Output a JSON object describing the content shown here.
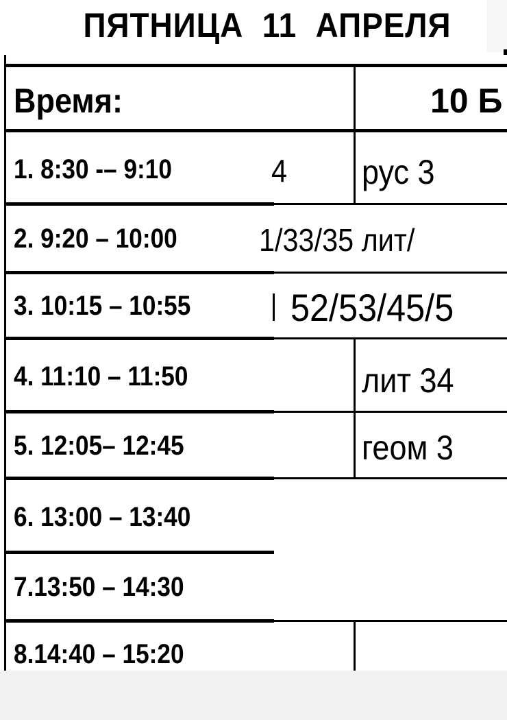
{
  "title": "ПЯТНИЦА  11  АПРЕЛЯ",
  "header": {
    "time_label": "Время:",
    "class_label": "10 Б"
  },
  "rows": [
    {
      "time": "1. 8:30 -– 9:10",
      "left_fragment": "4",
      "cell": "рус    3"
    },
    {
      "time": "2. 9:20 – 10:00",
      "cell": "1/33/35  лит/"
    },
    {
      "time": "3. 10:15 – 10:55",
      "cell": "52/53/45/5"
    },
    {
      "time": "4. 11:10 – 11:50",
      "cell": "лит   34"
    },
    {
      "time": "5. 12:05– 12:45",
      "cell": "геом  3"
    },
    {
      "time": "6. 13:00 – 13:40",
      "cell": ""
    },
    {
      "time": "7.13:50 – 14:30",
      "cell": ""
    },
    {
      "time": "8.14:40 – 15:20",
      "cell": ""
    }
  ]
}
